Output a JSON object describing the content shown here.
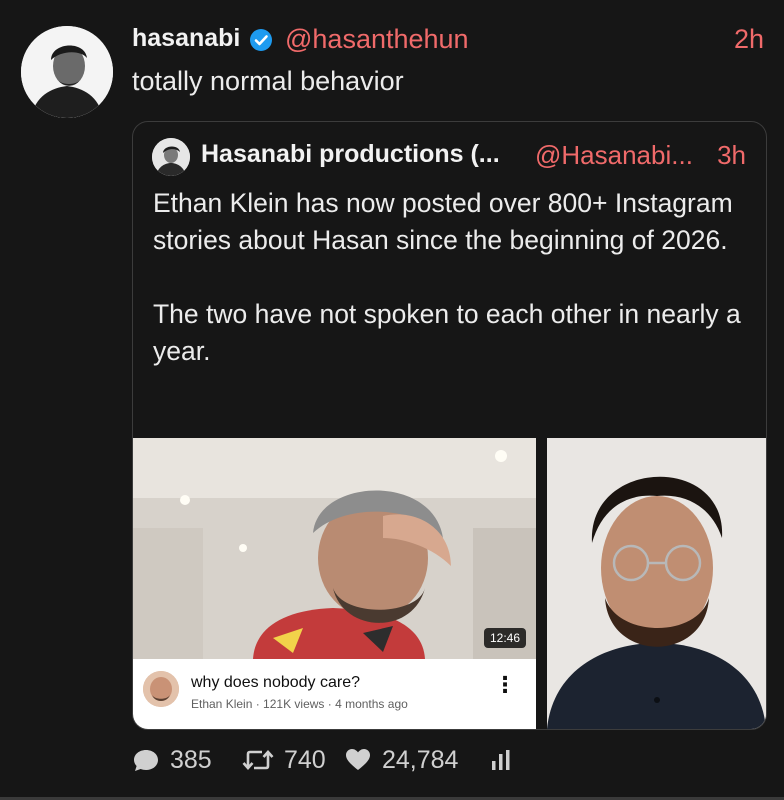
{
  "tweet": {
    "author_name": "hasanabi",
    "handle": "@hasanthehun",
    "time": "2h",
    "text": "totally normal behavior"
  },
  "quoted": {
    "author_name": "Hasanabi productions (...",
    "handle": "@Hasanabi...",
    "time": "3h",
    "paragraphs": [
      "Ethan Klein has now posted over 800+ Instagram stories about Hasan since the beginning of 2026.",
      "The two have not spoken to each other in nearly a year."
    ],
    "video_card": {
      "duration": "12:46",
      "title": "why does nobody care?",
      "meta": "Ethan Klein · 121K views · 4 months ago"
    }
  },
  "actions": {
    "replies": "385",
    "reposts": "740",
    "likes": "24,784"
  },
  "colors": {
    "background": "#161616",
    "accent": "#f06a6a",
    "verified": "#1d9bf0",
    "text": "#ececec"
  },
  "icons": [
    "verified-badge-icon",
    "reply-icon",
    "repost-icon",
    "like-icon",
    "analytics-icon",
    "more-vertical-icon"
  ]
}
